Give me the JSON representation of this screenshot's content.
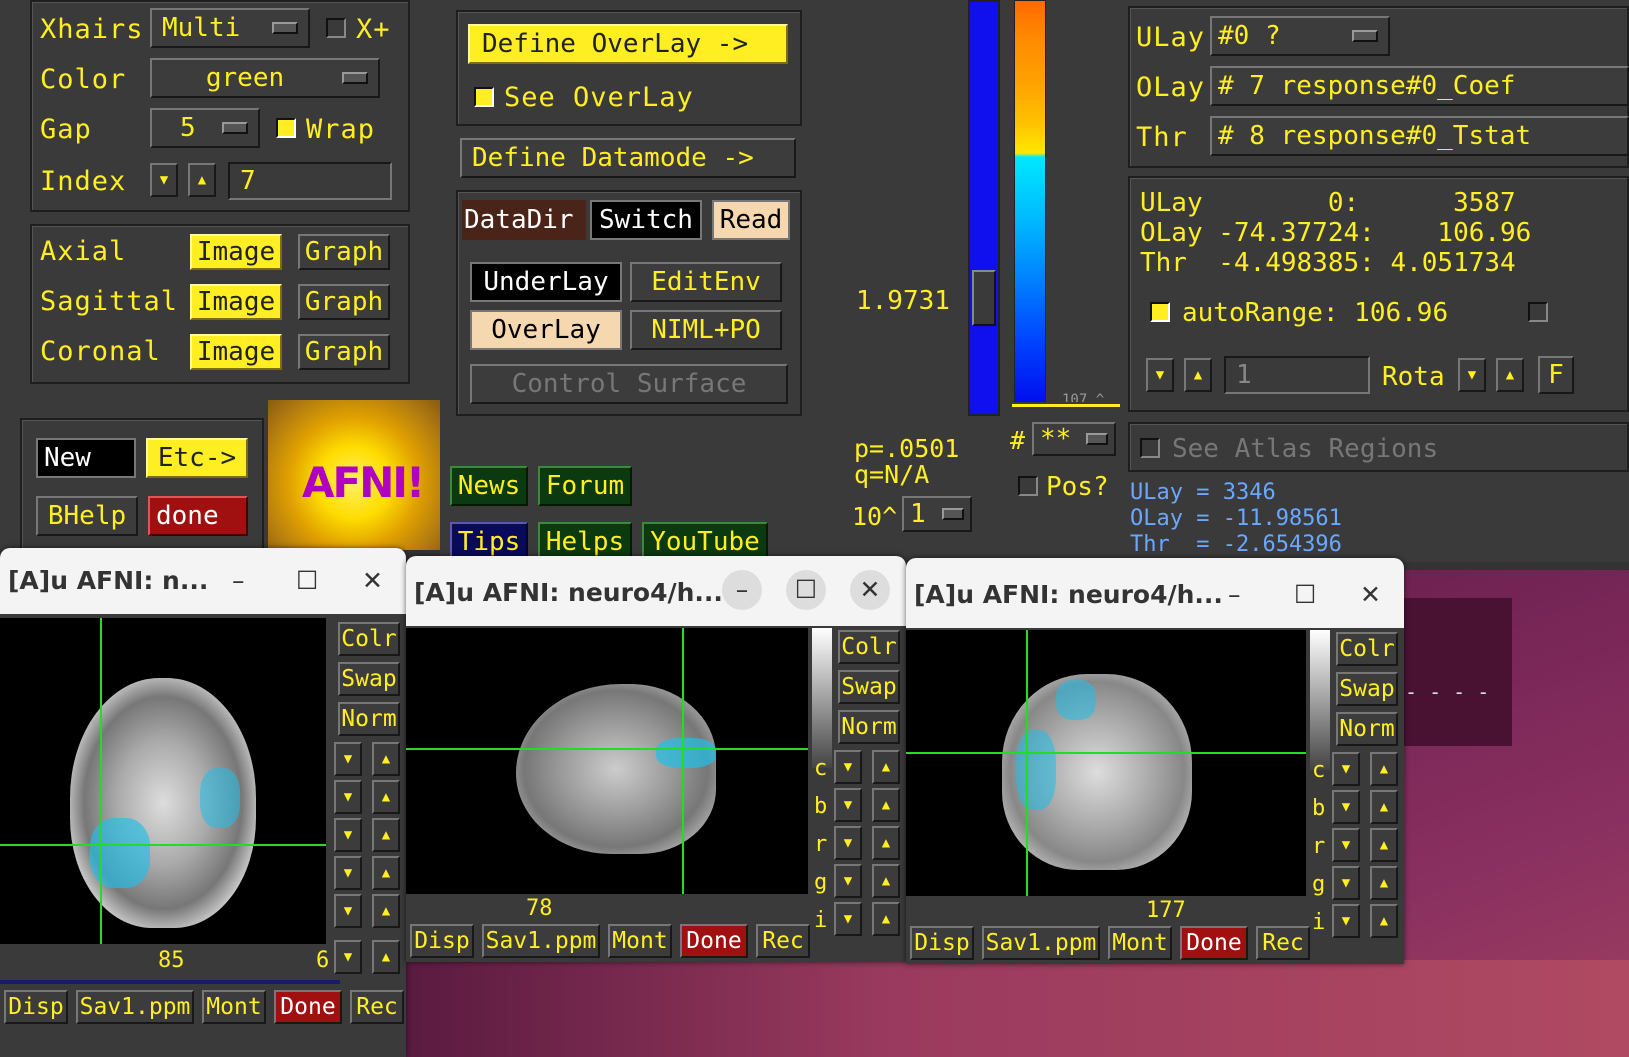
{
  "desktop": {
    "bg": "#7a2a5a"
  },
  "ctrl": {
    "xhairs_label": "Xhairs",
    "xhairs_value": "Multi",
    "xplus_label": "X+",
    "color_label": "Color",
    "color_value": "green",
    "gap_label": "Gap",
    "gap_value": "5",
    "wrap_label": "Wrap",
    "index_label": "Index",
    "index_value": "7",
    "axial_label": "Axial",
    "sagittal_label": "Sagittal",
    "coronal_label": "Coronal",
    "image_label": "Image",
    "graph_label": "Graph",
    "new_label": "New",
    "etc_label": "Etc->",
    "bhelp_label": "BHelp",
    "done_label": "done",
    "logo_text": "AFNI!"
  },
  "middle": {
    "define_overlay": "Define OverLay ->",
    "see_overlay": "See OverLay",
    "define_datamode": "Define Datamode ->",
    "datadir": "DataDir",
    "switch": "Switch",
    "read": "Read",
    "underlay": "UnderLay",
    "editenv": "EditEnv",
    "overlay": "OverLay",
    "niml": "NIML+PO",
    "control_surface": "Control Surface",
    "news": "News",
    "forum": "Forum",
    "tips": "Tips",
    "helps": "Helps",
    "youtube": "YouTube"
  },
  "colorbar": {
    "threshold_value": "1.9731",
    "p_value": "p=.0501",
    "q_value": "q=N/A",
    "exponent_label": "10^",
    "exponent_value": "1",
    "hash_label": "#",
    "stars_value": "**",
    "pos_label": "Pos?",
    "scale_partial": "107 ^"
  },
  "right": {
    "ulay_label": "ULay",
    "ulay_value": "#0 ?",
    "olay_label": "OLay",
    "olay_value": "# 7 response#0_Coef",
    "thr_label": "Thr",
    "thr_value": "# 8 response#0_Tstat",
    "info_ulay": "ULay        0:      3587",
    "info_olay": "OLay -74.37724:    106.96",
    "info_thr": "Thr  -4.498385: 4.051734",
    "autorange_label": "autoRange: 106.96",
    "rota_label": "Rota",
    "rota_index": "1",
    "f_label": "F",
    "see_atlas": "See Atlas Regions",
    "val_ulay": "ULay = 3346",
    "val_olay": "OLay = -11.98561",
    "val_thr": "Thr  = -2.654396"
  },
  "windows": [
    {
      "title": "[A]u AFNI: n...",
      "slice": "85",
      "extra": "6"
    },
    {
      "title": "[A]u AFNI: neuro4/h...",
      "slice": "78"
    },
    {
      "title": "[A]u AFNI: neuro4/h...",
      "slice": "177"
    }
  ],
  "imgctl": {
    "colr": "Colr",
    "swap": "Swap",
    "norm": "Norm",
    "letters": [
      "c",
      "b",
      "r",
      "g",
      "i"
    ]
  },
  "bottom": {
    "disp": "Disp",
    "sav": "Sav1.ppm",
    "mont": "Mont",
    "done": "Done",
    "rec": "Rec"
  },
  "icons": {
    "minimize": "minimize-icon",
    "maximize": "maximize-icon",
    "close": "close-icon"
  }
}
